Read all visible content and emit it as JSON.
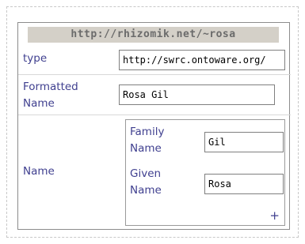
{
  "header": {
    "title": "http://rhizomik.net/~rosa"
  },
  "fields": {
    "type": {
      "label": "type",
      "value": "http://swrc.ontoware.org/"
    },
    "formatted_name": {
      "label_line1": "Formatted",
      "label_line2": "Name",
      "value": "Rosa Gil"
    },
    "name": {
      "label": "Name",
      "family_name": {
        "label_line1": "Family",
        "label_line2": "Name",
        "value": "Gil"
      },
      "given_name": {
        "label_line1": "Given",
        "label_line2": "Name",
        "value": "Rosa"
      },
      "add_label": "+"
    }
  }
}
